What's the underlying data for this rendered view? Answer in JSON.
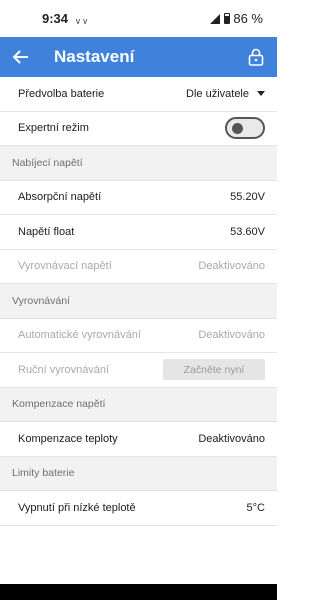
{
  "status": {
    "time": "9:34",
    "notif_icons": "ᵥ ᵥ",
    "battery_pct": "86 %"
  },
  "app_bar": {
    "title": "Nastavení"
  },
  "rows": {
    "battery_preset": {
      "label": "Předvolba baterie",
      "value": "Dle uživatele"
    },
    "expert_mode": {
      "label": "Expertní režim",
      "toggle_on": false
    },
    "absorption_voltage": {
      "label": "Absorpční napětí",
      "value": "55.20V"
    },
    "float_voltage": {
      "label": "Napětí float",
      "value": "53.60V"
    },
    "equalization_voltage": {
      "label": "Vyrovnávací napětí",
      "value": "Deaktivováno"
    },
    "auto_equalization": {
      "label": "Automatické vyrovnávání",
      "value": "Deaktivováno"
    },
    "manual_equalization": {
      "label": "Ruční vyrovnávání",
      "button": "Začněte nyní"
    },
    "temperature_compensation": {
      "label": "Kompenzace teploty",
      "value": "Deaktivováno"
    },
    "low_temp_cutoff": {
      "label": "Vypnutí při nízké teplotě",
      "value": "5°C"
    }
  },
  "sections": {
    "charge_voltages": "Nabíjecí napětí",
    "equalization": "Vyrovnávání",
    "voltage_compensation": "Kompenzace napětí",
    "battery_limits": "Limity baterie"
  },
  "colors": {
    "app_bar": "#3f81db",
    "section_bg": "#f2f2f2",
    "disabled_text": "#a9a9a9"
  }
}
